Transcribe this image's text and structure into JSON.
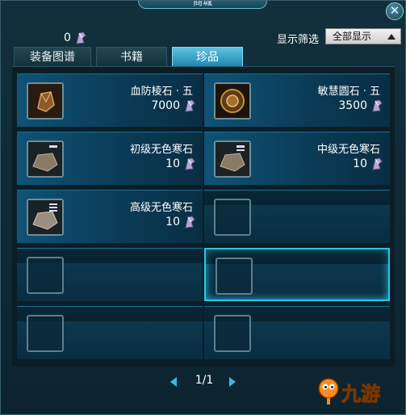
{
  "window": {
    "title": "商城",
    "close_label": "✕"
  },
  "currency": {
    "amount": "0",
    "icon": "jade-icon"
  },
  "filter": {
    "label": "显示筛选",
    "selected": "全部显示"
  },
  "tabs": [
    {
      "label": "装备图谱",
      "active": false
    },
    {
      "label": "书籍",
      "active": false
    },
    {
      "label": "珍品",
      "active": true
    }
  ],
  "items": [
    {
      "name": "血防棱石 · 五",
      "price": "7000",
      "icon": "gem-icon"
    },
    {
      "name": "敏慧圆石 · 五",
      "price": "3500",
      "icon": "round-stone-icon"
    },
    {
      "name": "初级无色寒石",
      "price": "10",
      "icon": "cold-stone-icon"
    },
    {
      "name": "中级无色寒石",
      "price": "10",
      "icon": "cold-stone-icon"
    },
    {
      "name": "高级无色寒石",
      "price": "10",
      "icon": "cold-stone-icon"
    }
  ],
  "pager": {
    "current_page": 1,
    "total_pages": 1,
    "label": "1/1"
  },
  "logo": {
    "text": "九游"
  },
  "colors": {
    "accent": "#3fb4e8",
    "selected_border": "#2cc6e0",
    "logo_orange": "#ff8a1e"
  }
}
